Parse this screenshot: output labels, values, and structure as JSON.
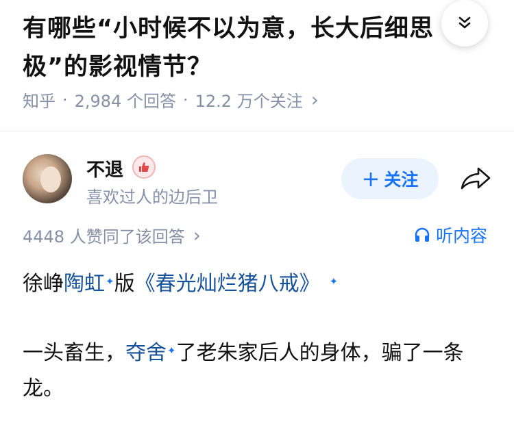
{
  "question": {
    "title_line1": "有哪些“小时候不以为意，长大后细思",
    "title_line2": "极”的影视情节？",
    "source": "知乎",
    "answers_count": "2,984 个回答",
    "followers": "12.2 万个关注"
  },
  "author": {
    "name": "不退",
    "bio": "喜欢过人的边后卫",
    "follow_label": "关注"
  },
  "answer": {
    "likes": "4448 人赞同了该回答",
    "listen_label": "听内容",
    "p1_prefix": "徐峥",
    "p1_link1": "陶虹",
    "p1_mid": "版",
    "p1_link2": "《春光灿烂猪八戒》",
    "p2_prefix": "一头畜生，",
    "p2_link": "夺舍",
    "p2_suffix": "了老朱家后人的身体，骗了一条龙。"
  },
  "icons": {
    "sparkle": "✦",
    "chevron_right": "›",
    "plus": "+"
  },
  "colors": {
    "accent": "#1772f6",
    "link": "#175199",
    "meta": "#8590a6"
  }
}
